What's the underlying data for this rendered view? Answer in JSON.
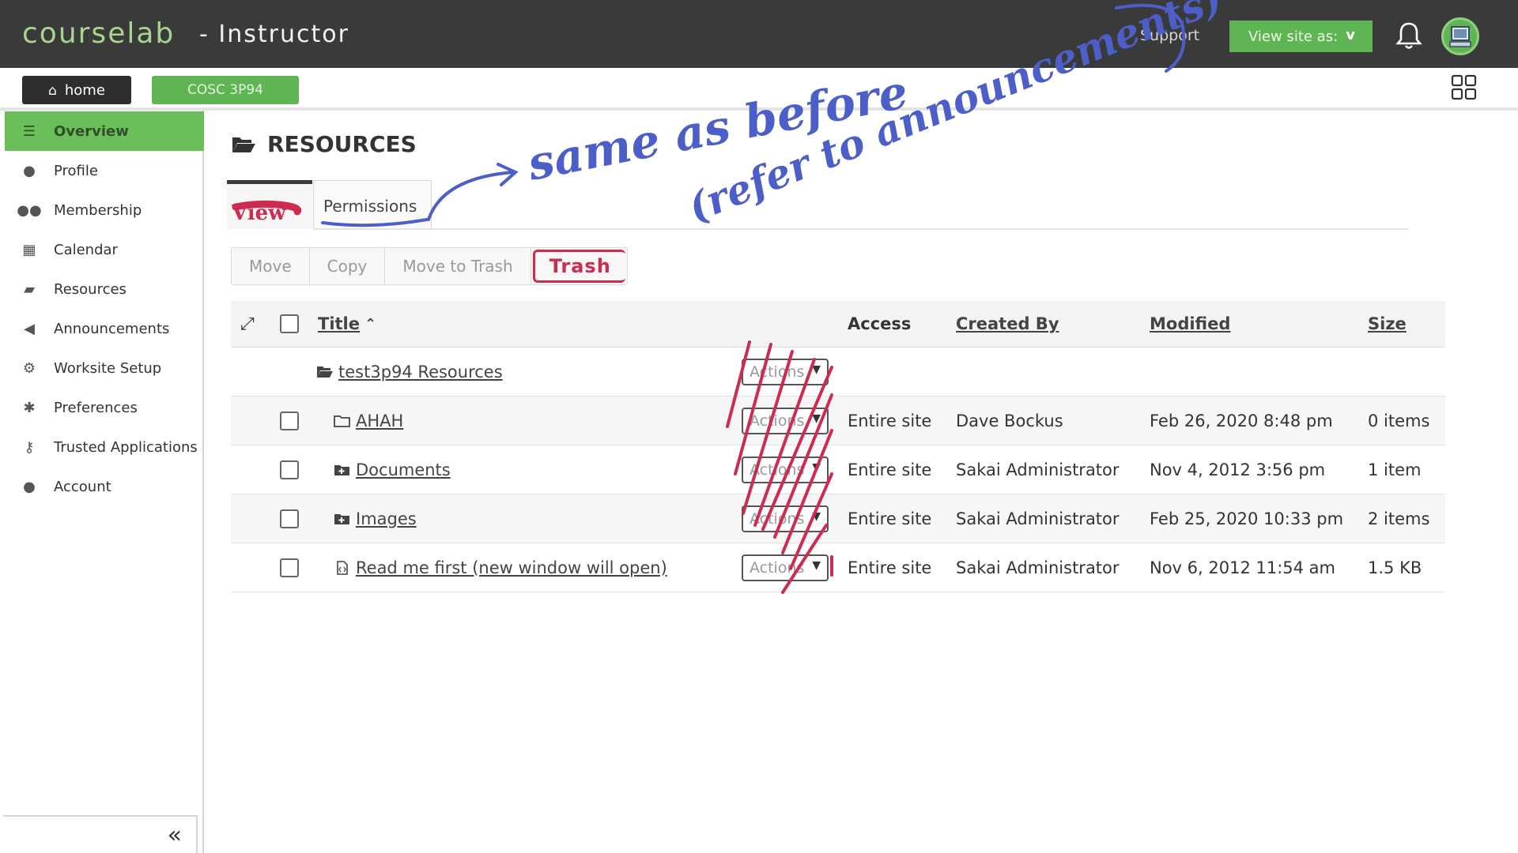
{
  "app": {
    "brand": "courselab",
    "role": "- Instructor",
    "support_label": "Support",
    "view_as_label": "View site as:",
    "view_as_value": "v"
  },
  "subnav": {
    "home_label": "home",
    "site_label": "COSC 3P94"
  },
  "sidebar": {
    "items": [
      {
        "label": "Overview",
        "icon": "list-icon",
        "active": true
      },
      {
        "label": "Profile",
        "icon": "user-icon"
      },
      {
        "label": "Membership",
        "icon": "users-icon"
      },
      {
        "label": "Calendar",
        "icon": "calendar-icon"
      },
      {
        "label": "Resources",
        "icon": "folder-open-icon"
      },
      {
        "label": "Announcements",
        "icon": "bullhorn-icon"
      },
      {
        "label": "Worksite Setup",
        "icon": "cogs-icon"
      },
      {
        "label": "Preferences",
        "icon": "gear-icon"
      },
      {
        "label": "Trusted Applications",
        "icon": "key-icon"
      },
      {
        "label": "Account",
        "icon": "user-icon"
      }
    ],
    "collapse_icon": "double-chevron-left-icon"
  },
  "page": {
    "title": "RESOURCES"
  },
  "tabs": {
    "view_label": "View",
    "permissions_label": "Permissions"
  },
  "toolbar": {
    "move": "Move",
    "copy": "Copy",
    "move_to_trash": "Move to Trash",
    "trash": "Trash"
  },
  "table": {
    "headers": {
      "title": "Title",
      "access": "Access",
      "created_by": "Created By",
      "modified": "Modified",
      "size": "Size"
    },
    "root": {
      "title": "test3p94 Resources",
      "actions": "Actions"
    },
    "rows": [
      {
        "title": "AHAH",
        "icon": "folder-outline-icon",
        "actions": "Actions",
        "access": "Entire site",
        "created_by": "Dave Bockus",
        "modified": "Feb 26, 2020 8:48 pm",
        "size": "0 items"
      },
      {
        "title": "Documents",
        "icon": "folder-plus-icon",
        "actions": "Actions",
        "access": "Entire site",
        "created_by": "Sakai Administrator",
        "modified": "Nov 4, 2012 3:56 pm",
        "size": "1 item"
      },
      {
        "title": "Images",
        "icon": "folder-plus-icon",
        "actions": "Actions",
        "access": "Entire site",
        "created_by": "Sakai Administrator",
        "modified": "Feb 25, 2020 10:33 pm",
        "size": "2 items"
      },
      {
        "title": "Read me first (new window will open)",
        "icon": "file-code-icon",
        "actions": "Actions",
        "access": "Entire site",
        "created_by": "Sakai Administrator",
        "modified": "Nov 6, 2012 11:54 am",
        "size": "1.5 KB"
      }
    ]
  },
  "annotations": {
    "line1": "same as before",
    "line2": "(refer to announcements)",
    "color_blue": "#4c5fc9",
    "color_red": "#cc2c4f"
  },
  "colors": {
    "topbar": "#3a3a3a",
    "brand_green": "#a7d48e",
    "accent_green": "#5fb553",
    "active_green": "#6bbf5a"
  }
}
